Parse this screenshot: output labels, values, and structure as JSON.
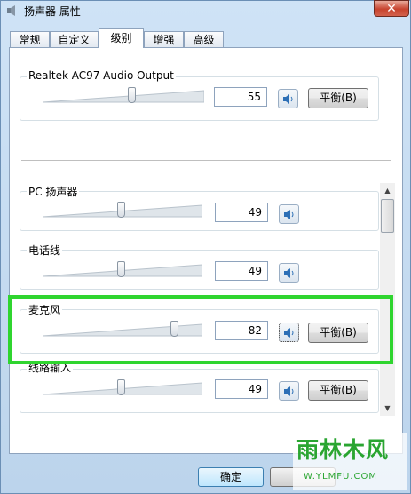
{
  "window": {
    "title": "扬声器 属性",
    "close_glyph": "✕"
  },
  "tabs": [
    {
      "label": "常规",
      "active": false
    },
    {
      "label": "自定义",
      "active": false
    },
    {
      "label": "级别",
      "active": true
    },
    {
      "label": "增强",
      "active": false
    },
    {
      "label": "高级",
      "active": false
    }
  ],
  "master": {
    "label": "Realtek AC97 Audio Output",
    "value": "55",
    "level": 0.55,
    "balance_label": "平衡(B)"
  },
  "channels": [
    {
      "label": "PC 扬声器",
      "value": "49",
      "level": 0.49
    },
    {
      "label": "电话线",
      "value": "49",
      "level": 0.49
    },
    {
      "label": "麦克风",
      "value": "82",
      "level": 0.82,
      "balance_label": "平衡(B)",
      "highlighted": true
    },
    {
      "label": "线路输入",
      "value": "49",
      "level": 0.49,
      "balance_label": "平衡(B)"
    }
  ],
  "buttons": {
    "ok": "确定"
  },
  "icons": {
    "mute": "speaker-icon",
    "scroll_up": "scroll-up-icon",
    "scroll_down": "scroll-down-icon"
  },
  "colors": {
    "highlight": "#2fd52f",
    "watermark": "#2aa531"
  },
  "watermark": {
    "text": "雨林木风",
    "url": "W.YLMFU.COM"
  }
}
